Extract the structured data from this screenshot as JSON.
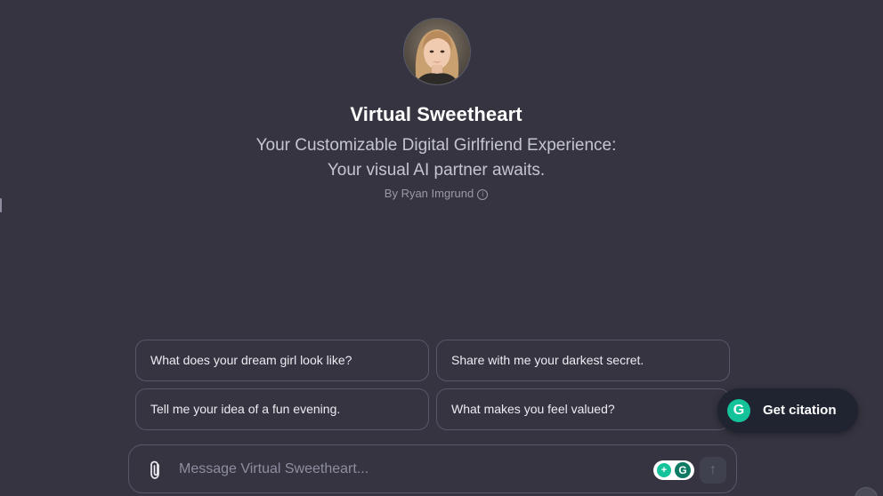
{
  "gpt": {
    "name": "Virtual Sweetheart",
    "description_line1": "Your Customizable Digital Girlfriend Experience:",
    "description_line2": "Your visual AI partner awaits.",
    "author": "By Ryan Imgrund",
    "avatar_icon": "avatar-portrait"
  },
  "suggestions": [
    {
      "label": "What does your dream girl look like?"
    },
    {
      "label": "Share with me your darkest secret."
    },
    {
      "label": "Tell me your idea of a fun evening."
    },
    {
      "label": "What makes you feel valued?"
    }
  ],
  "composer": {
    "placeholder": "Message Virtual Sweetheart...",
    "attach_icon": "paperclip-icon",
    "send_icon": "arrow-up-icon"
  },
  "citation": {
    "label": "Get citation",
    "logo_letter": "G"
  },
  "grammarly": {
    "logo_letter": "G"
  },
  "colors": {
    "background": "#353440",
    "border": "#565869",
    "accent": "#15c39a",
    "text_primary": "#ffffff",
    "text_secondary": "#c5c5d2"
  }
}
